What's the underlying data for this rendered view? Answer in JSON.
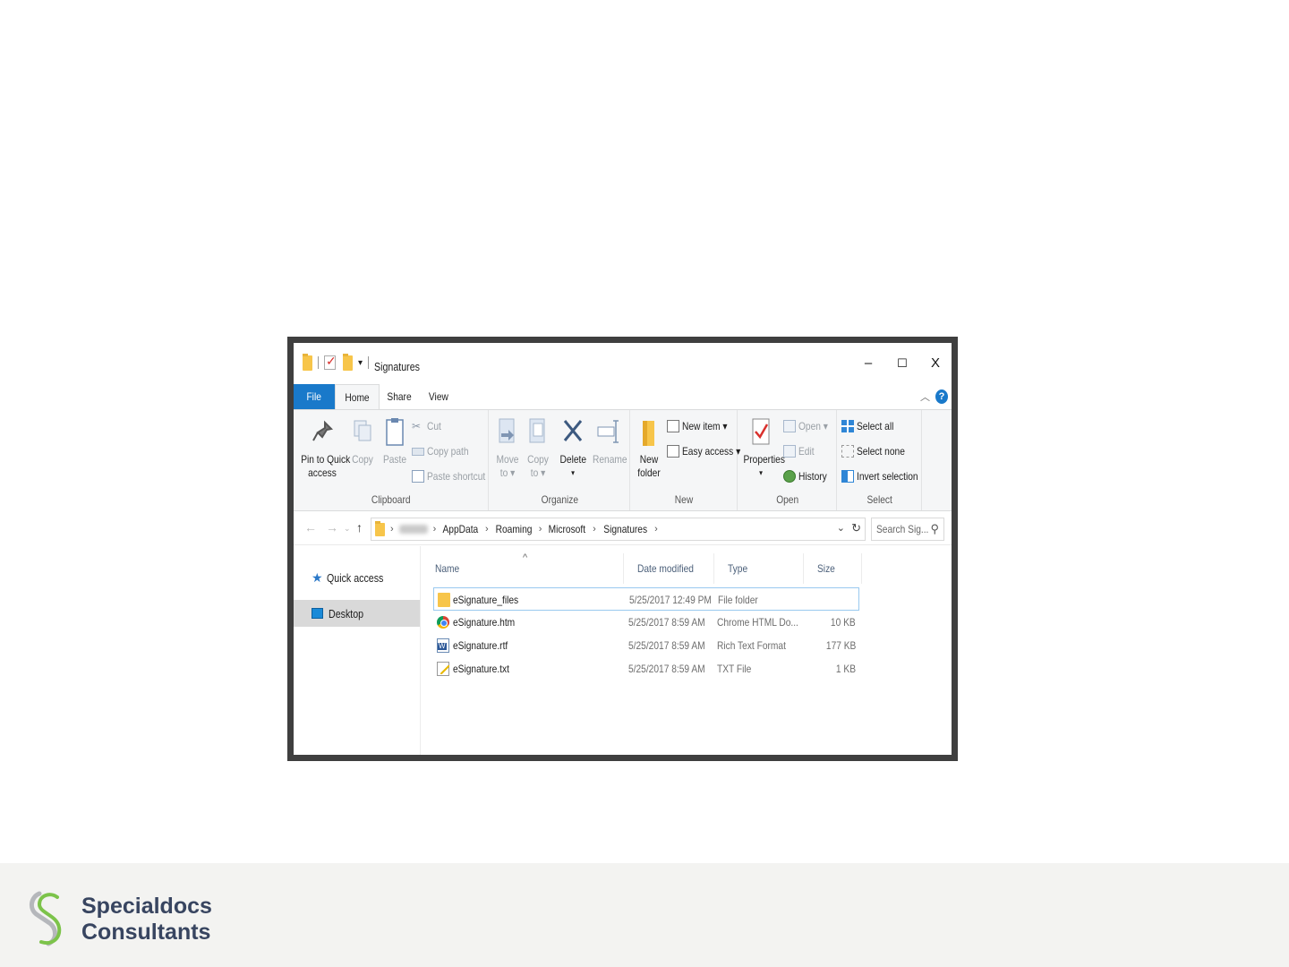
{
  "window": {
    "title": "Signatures",
    "qat_dropdown": "▾",
    "controls": {
      "minimize": "–",
      "maximize": "☐",
      "close": "X"
    }
  },
  "ribbon": {
    "tabs": [
      "File",
      "Home",
      "Share",
      "View"
    ],
    "active_tab": "Home",
    "groups": {
      "clipboard": {
        "label": "Clipboard",
        "pin": "Pin to Quick access",
        "pin_line1": "Pin to Quick",
        "pin_line2": "access",
        "copy": "Copy",
        "paste": "Paste",
        "cut": "Cut",
        "copy_path": "Copy path",
        "paste_shortcut": "Paste shortcut"
      },
      "organize": {
        "label": "Organize",
        "move_line1": "Move",
        "move_line2": "to ▾",
        "copy_line1": "Copy",
        "copy_line2": "to ▾",
        "delete_line1": "Delete",
        "delete_line2": "▾",
        "rename": "Rename"
      },
      "new": {
        "label": "New",
        "new_folder_line1": "New",
        "new_folder_line2": "folder",
        "new_item": "New item ▾",
        "easy_access": "Easy access ▾"
      },
      "open": {
        "label": "Open",
        "properties_line1": "Properties",
        "properties_line2": "▾",
        "open": "Open ▾",
        "edit": "Edit",
        "history": "History"
      },
      "select": {
        "label": "Select",
        "select_all": "Select all",
        "select_none": "Select none",
        "invert_selection": "Invert selection"
      }
    }
  },
  "address": {
    "crumbs": [
      "AppData",
      "Roaming",
      "Microsoft",
      "Signatures"
    ],
    "search_placeholder": "Search Sig..."
  },
  "nav_pane": {
    "items": [
      {
        "label": "Quick access",
        "icon": "star-icon"
      },
      {
        "label": "Desktop",
        "icon": "desktop-icon",
        "selected": true
      }
    ]
  },
  "file_list": {
    "columns": [
      "Name",
      "Date modified",
      "Type",
      "Size"
    ],
    "sort_indicator": "^",
    "rows": [
      {
        "name": "eSignature_files",
        "date": "5/25/2017 12:49 PM",
        "type": "File folder",
        "size": "",
        "icon": "folder-icon",
        "selected": true
      },
      {
        "name": "eSignature.htm",
        "date": "5/25/2017 8:59 AM",
        "type": "Chrome HTML Do...",
        "size": "10 KB",
        "icon": "chrome-icon"
      },
      {
        "name": "eSignature.rtf",
        "date": "5/25/2017 8:59 AM",
        "type": "Rich Text Format",
        "size": "177 KB",
        "icon": "word-doc-icon"
      },
      {
        "name": "eSignature.txt",
        "date": "5/25/2017 8:59 AM",
        "type": "TXT File",
        "size": "1 KB",
        "icon": "text-file-icon"
      }
    ]
  },
  "footer": {
    "brand_line1": "Specialdocs",
    "brand_line2": "Consultants",
    "colors": {
      "brand_text": "#384560",
      "logo_green": "#7cc34a",
      "logo_gray": "#b5b7bb"
    }
  }
}
